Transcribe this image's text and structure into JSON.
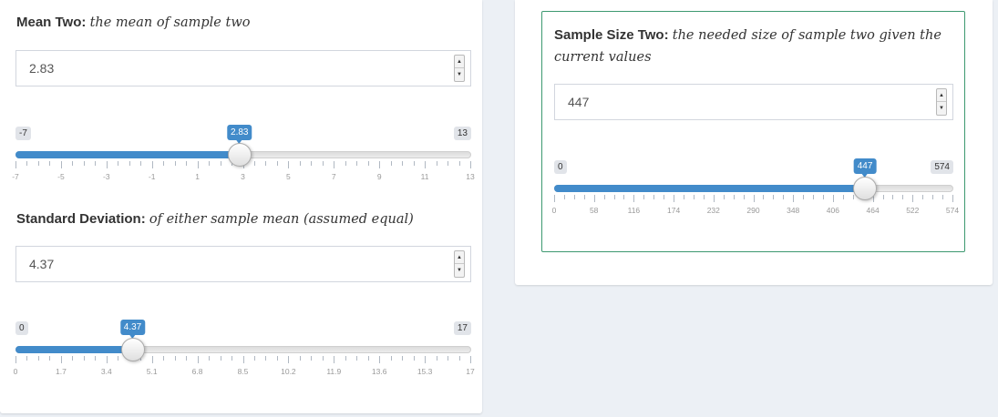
{
  "left_panel": {
    "mean_two": {
      "label_bold": "Mean Two:",
      "label_italic": "the mean of sample two",
      "input_value": "2.83",
      "slider": {
        "min_label": "-7",
        "max_label": "13",
        "current_label": "2.83",
        "min": -7,
        "max": 13,
        "value": 2.83,
        "tick_labels": [
          "-7",
          "-5",
          "-3",
          "-1",
          "1",
          "3",
          "5",
          "7",
          "9",
          "11",
          "13"
        ]
      }
    },
    "std_dev": {
      "label_bold": "Standard Deviation:",
      "label_italic": "of either sample mean (assumed equal)",
      "input_value": "4.37",
      "slider": {
        "min_label": "0",
        "max_label": "17",
        "current_label": "4.37",
        "min": 0,
        "max": 17,
        "value": 4.37,
        "tick_labels": [
          "0",
          "1.7",
          "3.4",
          "5.1",
          "6.8",
          "8.5",
          "10.2",
          "11.9",
          "13.6",
          "15.3",
          "17"
        ]
      }
    }
  },
  "right_panel": {
    "sample_size_two": {
      "label_bold": "Sample Size Two:",
      "label_italic_line1": "the needed size of sample two given the",
      "label_italic_line2": "current values",
      "input_value": "447",
      "slider": {
        "min_label": "0",
        "max_label": "574",
        "current_label": "447",
        "min": 0,
        "max": 574,
        "value": 447,
        "tick_labels": [
          "0",
          "58",
          "116",
          "174",
          "232",
          "290",
          "348",
          "406",
          "464",
          "522",
          "574"
        ]
      }
    }
  },
  "colors": {
    "accent": "#428bca",
    "box_border": "#3d9970",
    "background": "#ecf0f5"
  }
}
